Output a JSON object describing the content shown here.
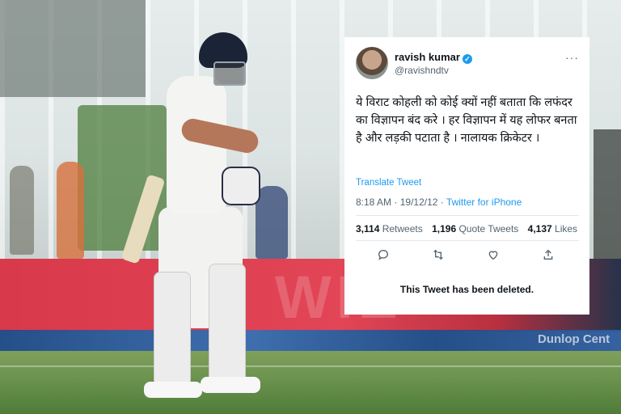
{
  "tweet": {
    "display_name": "ravish kumar",
    "handle": "@ravishndtv",
    "text": "ये विराट कोहली को कोई क्यों नहीं बताता कि लफंदर का विज्ञापन बंद करे । हर विज्ञापन में यह लोफर बनता है और लड़की पटाता है । नालायक क्रिकेटर ।",
    "translate_label": "Translate Tweet",
    "time": "8:18 AM",
    "date": "19/12/12",
    "separator": "·",
    "app": "Twitter for iPhone",
    "stats": {
      "retweets_count": "3,114",
      "retweets_label": "Retweets",
      "quotes_count": "1,196",
      "quotes_label": "Quote Tweets",
      "likes_count": "4,137",
      "likes_label": "Likes"
    },
    "deleted_notice": "This Tweet has been deleted.",
    "verified_icon": "verified-badge-icon",
    "more_icon": "more-horizontal-icon"
  },
  "background": {
    "board_text": "WIE",
    "strip_text": "Dunlop Cent"
  },
  "colors": {
    "link_blue": "#1d9bf0",
    "text_primary": "#0f1419",
    "text_secondary": "#536471",
    "board_red": "#e24556",
    "grass_green": "#6d9450"
  }
}
